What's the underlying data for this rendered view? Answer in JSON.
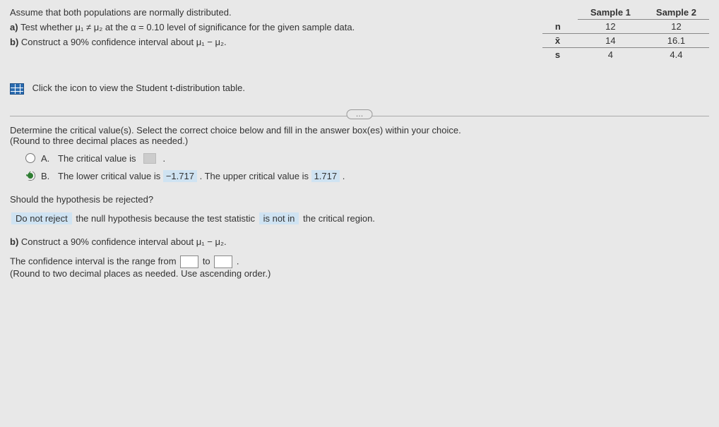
{
  "problem": {
    "intro": "Assume that both populations are normally distributed.",
    "part_a_label": "a) ",
    "part_a": "Test whether μ₁ ≠ μ₂ at the α = 0.10 level of significance for the given sample data.",
    "part_b_label": "b) ",
    "part_b": "Construct a 90% confidence interval about μ₁ − μ₂."
  },
  "table": {
    "header_blank": "",
    "header_s1": "Sample 1",
    "header_s2": "Sample 2",
    "row_n": "n",
    "row_x": "x̄",
    "row_s": "s",
    "n1": "12",
    "n2": "12",
    "x1": "14",
    "x2": "16.1",
    "s1": "4",
    "s2": "4.4"
  },
  "icon_link": "Click the icon to view the Student t-distribution table.",
  "ellipsis": "…",
  "crit": {
    "instruction": "Determine the critical value(s). Select the correct choice below and fill in the answer box(es) within your choice.",
    "round": "(Round to three decimal places as needed.)",
    "A_letter": "A.",
    "A_text": "The critical value is ",
    "B_letter": "B.",
    "B_text_1": "The lower critical value is ",
    "B_val_lower": "−1.717",
    "B_text_2": ". The upper critical value is ",
    "B_val_upper": "1.717",
    "B_text_3": "."
  },
  "reject": {
    "question": "Should the hypothesis be rejected?",
    "ans1": "Do not reject",
    "mid1": " the null hypothesis because the test statistic ",
    "ans2": "is not in",
    "mid2": " the critical region."
  },
  "ci": {
    "title_label": "b) ",
    "title": "Construct a 90% confidence interval about μ₁ − μ₂.",
    "line1_a": "The confidence interval is the range from ",
    "line1_to": " to ",
    "line1_end": ".",
    "round": "(Round to two decimal places as needed. Use ascending order.)"
  }
}
